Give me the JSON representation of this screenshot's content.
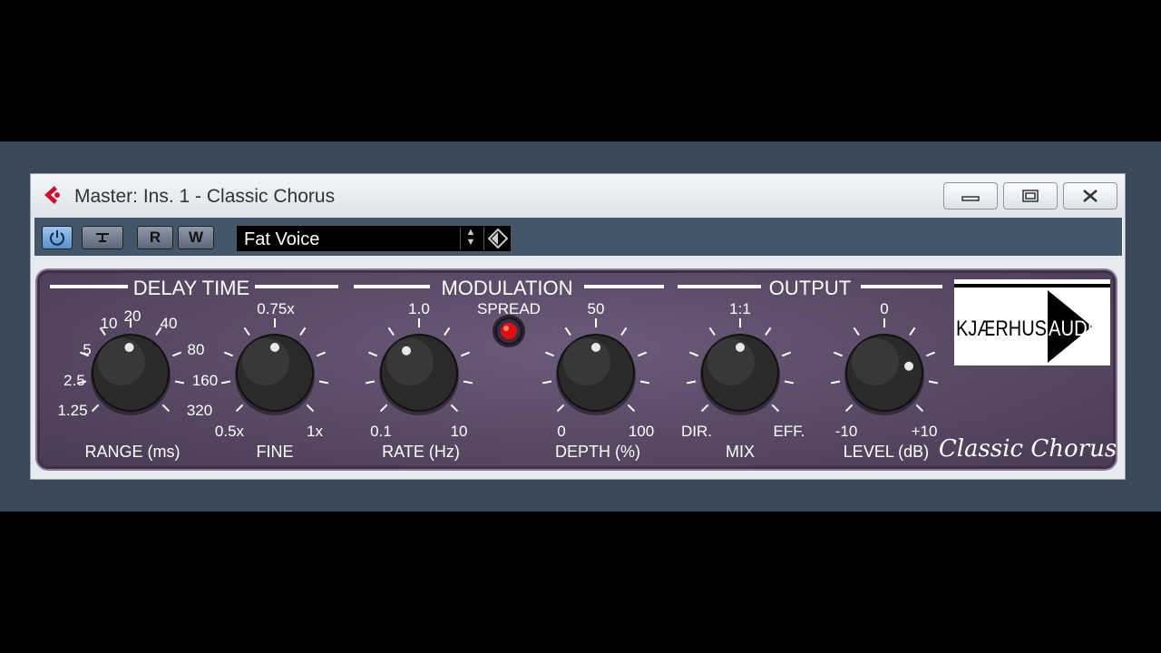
{
  "window": {
    "title": "Master: Ins. 1 - Classic Chorus",
    "controls": [
      "minimize-icon",
      "maximize-icon",
      "close-icon"
    ]
  },
  "toolbar": {
    "power_icon": "power-icon",
    "bypass_icon": "bypass-icon",
    "read_label": "R",
    "write_label": "W",
    "preset_name": "Fat Voice"
  },
  "sections": {
    "delay_time": "DELAY TIME",
    "modulation": "MODULATION",
    "output": "OUTPUT"
  },
  "knobs": {
    "range": {
      "label": "RANGE (ms)",
      "ticks": [
        "1.25",
        "2.5",
        "5",
        "10",
        "20",
        "40",
        "80",
        "160",
        "320"
      ],
      "value": "20"
    },
    "fine": {
      "label": "FINE",
      "top": "0.75x",
      "min": "0.5x",
      "max": "1x"
    },
    "rate": {
      "label": "RATE (Hz)",
      "top": "1.0",
      "min": "0.1",
      "max": "10"
    },
    "depth": {
      "label": "DEPTH (%)",
      "top": "50",
      "min": "0",
      "max": "100"
    },
    "mix": {
      "label": "MIX",
      "top": "1:1",
      "min": "DIR.",
      "max": "EFF."
    },
    "level": {
      "label": "LEVEL (dB)",
      "top": "0",
      "min": "-10",
      "max": "+10"
    }
  },
  "spread": {
    "label": "SPREAD",
    "led_color": "#e01010",
    "on": true
  },
  "brand": {
    "logo_left": "KJÆRHUS",
    "logo_right": "AUDIO",
    "product": "Classic Chorus"
  }
}
